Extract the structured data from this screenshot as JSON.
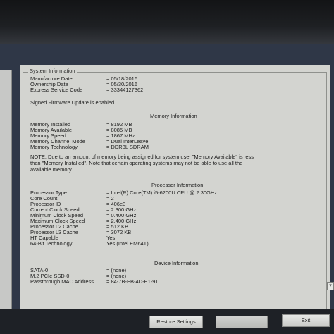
{
  "system_info": {
    "group_title": "System Information",
    "rows": [
      {
        "label": "Manufacture Date",
        "value": "= 05/18/2016"
      },
      {
        "label": "Ownership Date",
        "value": "= 05/30/2016"
      },
      {
        "label": "Express Service Code",
        "value": "= 33344127362"
      }
    ],
    "firmware_status": "Signed Firmware Update is enabled"
  },
  "memory": {
    "heading": "Memory Information",
    "rows": [
      {
        "label": "Memory Installed",
        "value": "= 8192 MB"
      },
      {
        "label": "Memory Available",
        "value": "= 8085 MB"
      },
      {
        "label": "Memory Speed",
        "value": "= 1867 MHz"
      },
      {
        "label": "Memory Channel Mode",
        "value": "= Dual InterLeave"
      },
      {
        "label": "Memory Technology",
        "value": "= DDR3L SDRAM"
      }
    ],
    "note_lines": [
      "NOTE: Due to an amount of memory being assigned for system use, \"Memory Available\" is less",
      "than \"Memory Installed\". Note that certain operating systems may not be able to use all the",
      "available memory."
    ]
  },
  "processor": {
    "heading": "Processor Information",
    "rows": [
      {
        "label": "Processor Type",
        "value": "= Intel(R) Core(TM) i5-6200U CPU @ 2.30GHz"
      },
      {
        "label": "Core Count",
        "value": "= 2"
      },
      {
        "label": "Processor ID",
        "value": "= 406e3"
      },
      {
        "label": "Current Clock Speed",
        "value": "= 2.300 GHz"
      },
      {
        "label": "Minimum Clock Speed",
        "value": "= 0.400 GHz"
      },
      {
        "label": "Maximum Clock Speed",
        "value": "= 2.400 GHz"
      },
      {
        "label": "Processor L2 Cache",
        "value": "= 512 KB"
      },
      {
        "label": "Processor L3 Cache",
        "value": "= 3072 KB"
      },
      {
        "label": "HT Capable",
        "value": "Yes"
      },
      {
        "label": "64-Bit Technology",
        "value": "Yes (Intel EM64T)"
      }
    ]
  },
  "device": {
    "heading": "Device Information",
    "rows": [
      {
        "label": "SATA-0",
        "value": "= (none)"
      },
      {
        "label": "M.2 PCIe SSD-0",
        "value": "= (none)"
      },
      {
        "label": "Passthrough MAC Address",
        "value": "= 84-7B-EB-4D-E1-91"
      }
    ]
  },
  "buttons": {
    "restore": "Restore Settings",
    "apply": "",
    "exit": "Exit"
  }
}
